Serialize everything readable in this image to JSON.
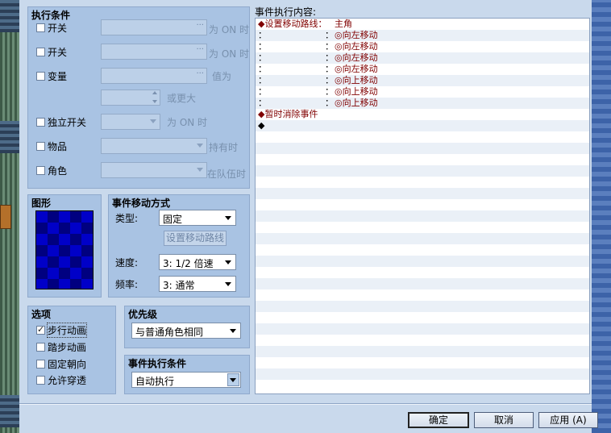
{
  "conditions": {
    "title": "执行条件",
    "switch1": {
      "label": "开关",
      "suffix": "为 ON 时",
      "dots": "···"
    },
    "switch2": {
      "label": "开关",
      "suffix": "为 ON 时",
      "dots": "···"
    },
    "variable": {
      "label": "变量",
      "suffix": "值为",
      "dots": "···",
      "or_more": "或更大"
    },
    "self_switch": {
      "label": "独立开关",
      "suffix": "为 ON 时"
    },
    "item": {
      "label": "物品",
      "suffix": "持有时"
    },
    "actor": {
      "label": "角色",
      "suffix": "在队伍时"
    }
  },
  "graphic": {
    "title": "图形"
  },
  "movement": {
    "title": "事件移动方式",
    "type_label": "类型:",
    "type_value": "固定",
    "route_button": "设置移动路线",
    "speed_label": "速度:",
    "speed_value": "3: 1/2 倍速",
    "freq_label": "频率:",
    "freq_value": "3: 通常"
  },
  "options": {
    "title": "选项",
    "items": [
      {
        "label": "步行动画",
        "checked": true
      },
      {
        "label": "踏步动画",
        "checked": false
      },
      {
        "label": "固定朝向",
        "checked": false
      },
      {
        "label": "允许穿透",
        "checked": false
      }
    ]
  },
  "priority": {
    "title": "优先级",
    "value": "与普通角色相同"
  },
  "trigger": {
    "title": "事件执行条件",
    "value": "自动执行"
  },
  "contents": {
    "title": "事件执行内容:",
    "rows": [
      {
        "c1": "◆设置移动路线：",
        "c2": "",
        "c3": "主角",
        "header": true
      },
      {
        "c1": "：",
        "c2": "：",
        "c3": "◎向左移动"
      },
      {
        "c1": "：",
        "c2": "：",
        "c3": "◎向左移动"
      },
      {
        "c1": "：",
        "c2": "：",
        "c3": "◎向左移动"
      },
      {
        "c1": "：",
        "c2": "：",
        "c3": "◎向左移动"
      },
      {
        "c1": "：",
        "c2": "：",
        "c3": "◎向上移动"
      },
      {
        "c1": "：",
        "c2": "：",
        "c3": "◎向上移动"
      },
      {
        "c1": "：",
        "c2": "：",
        "c3": "◎向上移动"
      },
      {
        "c1": "◆暂时消除事件",
        "c2": "",
        "c3": "",
        "header": true
      },
      {
        "c1": "◆",
        "c2": "",
        "c3": ""
      }
    ]
  },
  "buttons": {
    "ok": "确定",
    "cancel": "取消",
    "apply": "应用 (A)"
  }
}
